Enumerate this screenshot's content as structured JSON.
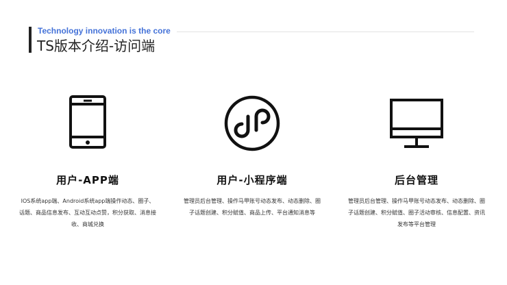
{
  "header": {
    "subtitle": "Technology innovation is the core",
    "title": "TS版本介绍-访问端"
  },
  "cards": [
    {
      "icon": "mobile-phone-icon",
      "title": "用户-APP端",
      "description": "IOS系统app端、Android系统app端操作动态、圈子、话题、商品信息发布、互动互动点赞，积分获取、消息接收、商城兑换"
    },
    {
      "icon": "mini-program-icon",
      "title": "用户-小程序端",
      "description": "管理员后台管理、操作马甲账号动态发布、动态删除、圈子话题创建、积分赋值、商品上传、平台通知消息等"
    },
    {
      "icon": "desktop-monitor-icon",
      "title": "后台管理",
      "description": "管理员后台管理、操作马甲账号动态发布、动态删除、圈子话题创建、积分赋值、圈子活动审核、信息配置、资讯发布等平台管理"
    }
  ],
  "colors": {
    "accent": "#4472d8",
    "text": "#111111",
    "bar": "#222222"
  }
}
